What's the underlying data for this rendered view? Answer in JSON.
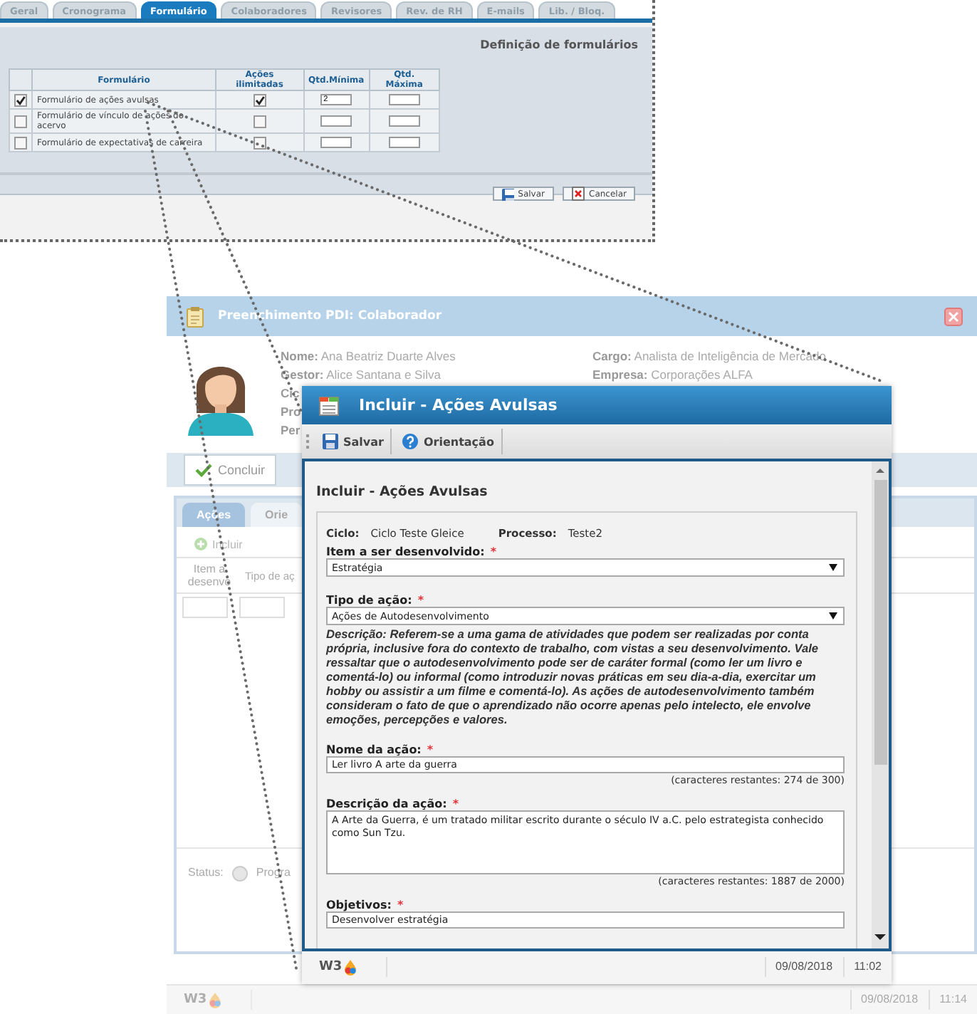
{
  "config_panel": {
    "tabs": [
      {
        "label": "Geral",
        "selected": false
      },
      {
        "label": "Cronograma",
        "selected": false
      },
      {
        "label": "Formulário",
        "selected": true
      },
      {
        "label": "Colaboradores",
        "selected": false
      },
      {
        "label": "Revisores",
        "selected": false
      },
      {
        "label": "Rev. de RH",
        "selected": false
      },
      {
        "label": "E-mails",
        "selected": false
      },
      {
        "label": "Lib. / Bloq.",
        "selected": false
      }
    ],
    "title": "Definição de formulários",
    "table": {
      "columns": [
        "Formulário",
        "Ações ilimitadas",
        "Qtd.Mínima",
        "Qtd. Máxima"
      ],
      "rows": [
        {
          "checked": true,
          "name": "Formulário de ações avulsas",
          "unlimited": true,
          "min": "2"
        },
        {
          "checked": false,
          "name": "Formulário de vínculo de ações do acervo",
          "unlimited": false
        },
        {
          "checked": false,
          "name": "Formulário de expectativas de carreira",
          "unlimited": false
        }
      ]
    },
    "buttons": [
      {
        "kind": "save",
        "label": "Salvar"
      },
      {
        "kind": "cancel",
        "label": "Cancelar"
      }
    ]
  },
  "collaborator_window": {
    "title": "Preenchimento PDI: Colaborador",
    "info_left": [
      {
        "label": "Nome:",
        "value": "Ana Beatriz Duarte Alves"
      },
      {
        "label": "Gestor:",
        "value": "Alice Santana e Silva"
      },
      {
        "label": "Cic"
      },
      {
        "label": "Pro"
      },
      {
        "label": "Per"
      }
    ],
    "info_right": [
      {
        "label": "Cargo:",
        "value": "Analista de Inteligência de Mercado"
      },
      {
        "label": "Empresa:",
        "value": "Corporações ALFA"
      }
    ],
    "toolbar": [
      {
        "label": "Concluir"
      }
    ],
    "tabs": [
      {
        "label": "Ações",
        "selected": true
      },
      {
        "label": "Orie",
        "selected": false
      }
    ],
    "grid_toolbar": [
      {
        "label": "Incluir",
        "disabled": true
      }
    ],
    "columns": [
      "Item a desenvo",
      "Tipo de aç"
    ],
    "status": {
      "label": "Status:",
      "options": [
        {
          "label": "Progra",
          "selected": false
        }
      ]
    },
    "status_bar": {
      "logo": "W3",
      "date": "09/08/2018",
      "time": "11:14"
    }
  },
  "modal": {
    "title": "Incluir - Ações Avulsas",
    "toolbar": [
      {
        "kind": "save",
        "label": "Salvar"
      },
      {
        "kind": "help",
        "label": "Orientação"
      }
    ],
    "heading": "Incluir - Ações Avulsas",
    "meta": [
      {
        "label": "Ciclo:",
        "value": "Ciclo Teste Gleice"
      },
      {
        "label": "Processo:",
        "value": "Teste2"
      }
    ],
    "fields": [
      {
        "kind": "select",
        "label": "Item a ser desenvolvido:",
        "required_mark": "*",
        "value": "Estratégia"
      },
      {
        "kind": "select",
        "label": "Tipo de ação:",
        "required_mark": "*",
        "value": "Ações de Autodesenvolvimento",
        "description": "Descrição: Referem-se a uma gama de atividades que podem ser realizadas por conta própria, inclusive fora do contexto de trabalho, com vistas a seu desenvolvimento. Vale ressaltar que o autodesenvolvimento pode ser de caráter formal (como ler um livro e comentá-lo) ou informal (como introduzir novas práticas em seu dia-a-dia, exercitar um hobby ou assistir a um filme e comentá-lo). As ações de autodesenvolvimento também consideram o fato de que o aprendizado não ocorre apenas pelo intelecto, ele envolve emoções, percepções e valores."
      },
      {
        "kind": "text",
        "label": "Nome da ação:",
        "required_mark": "*",
        "value": "Ler livro A arte da guerra",
        "counter": "(caracteres restantes: 274 de 300)"
      },
      {
        "kind": "textarea",
        "label": "Descrição da ação:",
        "required_mark": "*",
        "value": "A Arte da Guerra, é um tratado militar escrito durante o século IV a.C. pelo estrategista conhecido como Sun Tzu.",
        "counter": "(caracteres restantes: 1887 de 2000)"
      },
      {
        "kind": "text",
        "label": "Objetivos:",
        "required_mark": "*",
        "value": "Desenvolver estratégia"
      }
    ],
    "status_bar": {
      "logo": "W3",
      "date": "09/08/2018",
      "time": "11:02"
    }
  }
}
